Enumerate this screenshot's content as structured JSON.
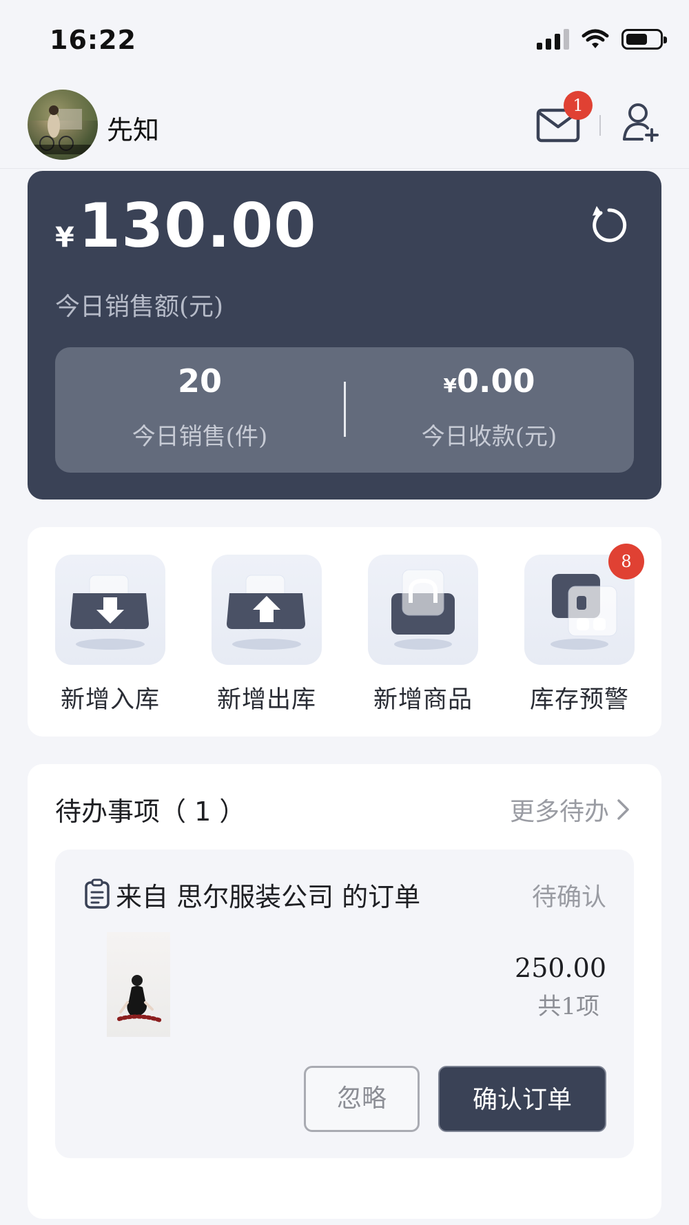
{
  "status_bar": {
    "time": "16:22"
  },
  "header": {
    "user_name": "先知",
    "mail_badge": "1",
    "mail_icon": "mail-icon",
    "add_user_icon": "add-user-icon"
  },
  "sales": {
    "currency": "¥",
    "amount": "130.00",
    "amount_label": "今日销售额(元)",
    "refresh_icon": "refresh-icon",
    "stats": [
      {
        "value": "20",
        "currency": "",
        "label": "今日销售(件)"
      },
      {
        "value": "0.00",
        "currency": "¥",
        "label": "今日收款(元)"
      }
    ]
  },
  "actions": [
    {
      "label": "新增入库",
      "icon": "stock-in-icon"
    },
    {
      "label": "新增出库",
      "icon": "stock-out-icon"
    },
    {
      "label": "新增商品",
      "icon": "new-product-icon"
    },
    {
      "label": "库存预警",
      "icon": "stock-warning-icon",
      "badge": "8"
    }
  ],
  "todo": {
    "title": "待办事项（ 1 ）",
    "more_label": "更多待办",
    "order": {
      "title": "来自 思尔服装公司 的订单",
      "status": "待确认",
      "price": "250.00",
      "count": "共1项",
      "ignore_label": "忽略",
      "confirm_label": "确认订单"
    }
  },
  "colors": {
    "card_dark": "#3a4256",
    "stats_box": "#636b7c",
    "badge_red": "#e04133",
    "background": "#f4f5f9"
  }
}
